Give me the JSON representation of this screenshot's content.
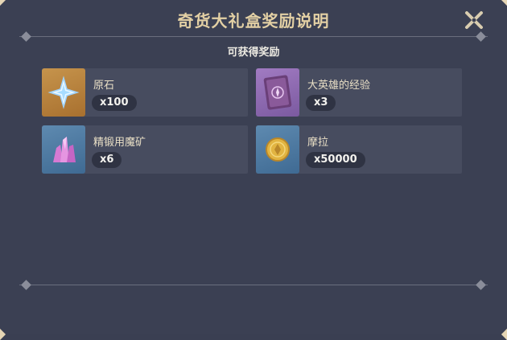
{
  "dialog": {
    "title": "奇货大礼盒奖励说明",
    "subtitle": "可获得奖励",
    "close_icon": "close-icon"
  },
  "rewards": [
    {
      "name": "原石",
      "quantity": "x100",
      "icon": "primogem-icon"
    },
    {
      "name": "大英雄的经验",
      "quantity": "x3",
      "icon": "heros-wit-icon"
    },
    {
      "name": "精锻用魔矿",
      "quantity": "x6",
      "icon": "mystic-enhancement-ore-icon"
    },
    {
      "name": "摩拉",
      "quantity": "x50000",
      "icon": "mora-icon"
    }
  ],
  "colors": {
    "background": "#3b4053",
    "title": "#e3d0a4",
    "card": "#474c5f",
    "rarity_gold": "#b67f39",
    "rarity_purple": "#8d69b2",
    "rarity_blue": "#4e7aa2"
  }
}
